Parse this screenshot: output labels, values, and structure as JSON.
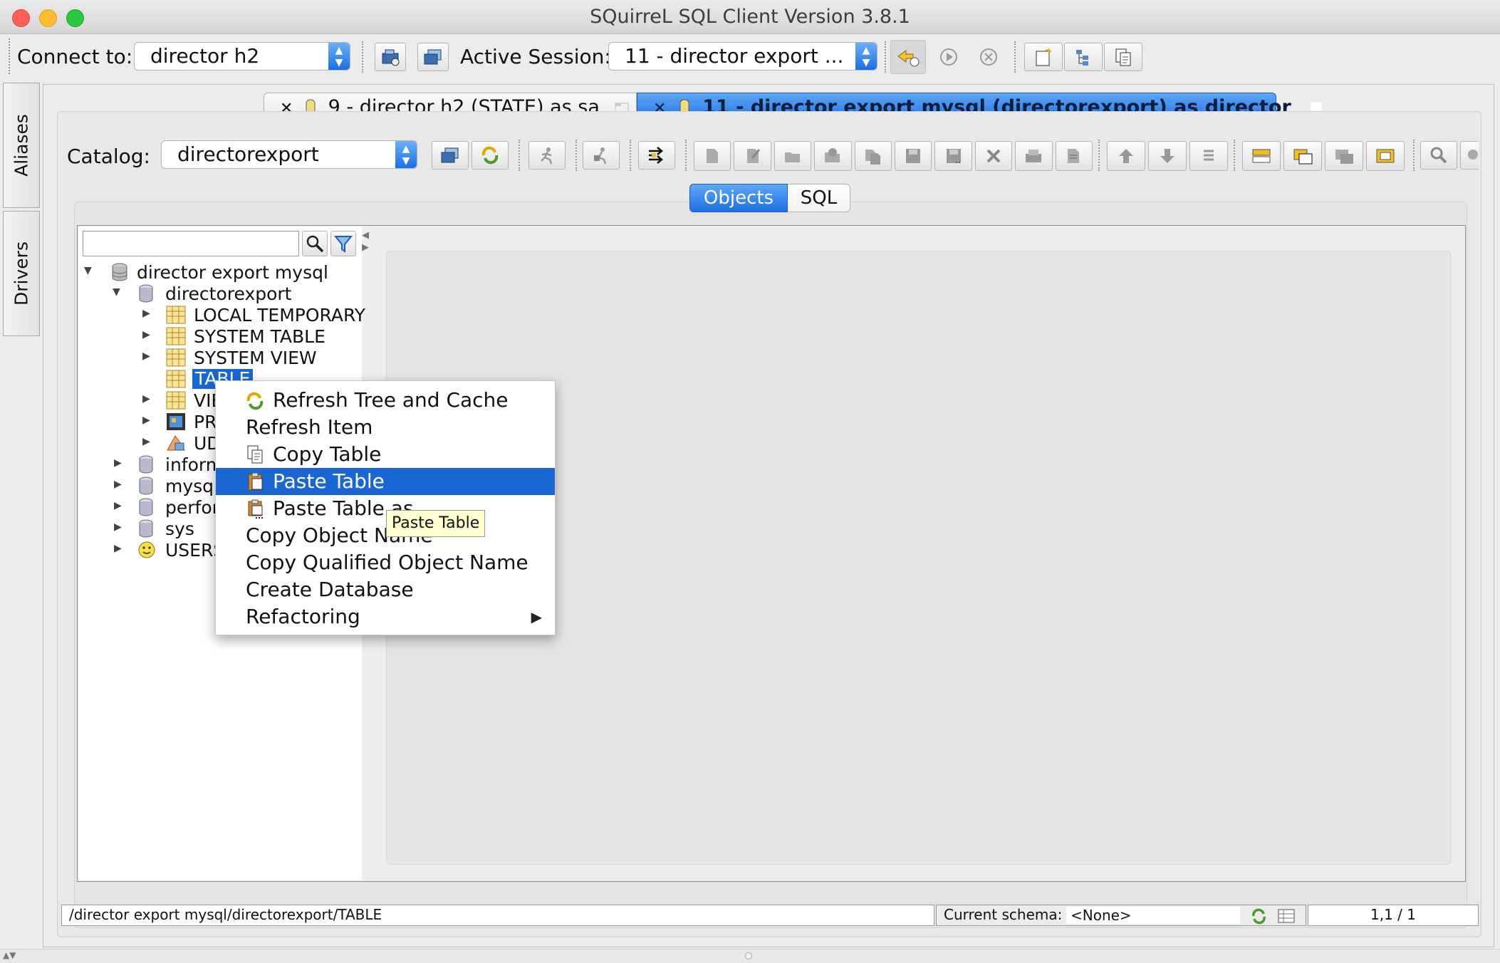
{
  "window": {
    "title": "SQuirreL SQL Client Version 3.8.1"
  },
  "toolbar": {
    "connect_label": "Connect to:",
    "connect_value": "director h2",
    "active_session_label": "Active Session:",
    "active_session_value": "11 - director export ..."
  },
  "side_tabs": {
    "aliases": "Aliases",
    "drivers": "Drivers"
  },
  "session_tabs": [
    {
      "label": "9 - director h2 (STATE) as sa",
      "active": false
    },
    {
      "label": "11 - director export mysql (directorexport) as director",
      "active": true
    }
  ],
  "session": {
    "catalog_label": "Catalog:",
    "catalog_value": "directorexport",
    "view_tabs": [
      {
        "label": "Objects",
        "active": true
      },
      {
        "label": "SQL",
        "active": false
      }
    ]
  },
  "tree": {
    "search_value": "",
    "root": "director export mysql",
    "schema": "directorexport",
    "children": [
      "LOCAL TEMPORARY",
      "SYSTEM TABLE",
      "SYSTEM VIEW",
      "TABLE",
      "VIE",
      "PR",
      "UD"
    ],
    "other_schemas": [
      "inform",
      "mysql",
      "perfor",
      "sys",
      "USERS"
    ]
  },
  "context_menu": {
    "items": [
      {
        "label": "Refresh Tree and Cache",
        "icon": "refresh-icon"
      },
      {
        "label": "Refresh Item"
      },
      {
        "label": "Copy Table",
        "icon": "copy-icon"
      },
      {
        "label": "Paste Table",
        "icon": "paste-icon",
        "selected": true
      },
      {
        "label": "Paste Table as",
        "icon": "paste-as-icon"
      },
      {
        "label": "Copy Object Name"
      },
      {
        "label": "Copy Qualified Object Name"
      },
      {
        "label": "Create Database"
      },
      {
        "label": "Refactoring",
        "submenu": true
      }
    ]
  },
  "tooltip": "Paste Table",
  "statusbar": {
    "path": "/director export mysql/directorexport/TABLE",
    "schema_label": "Current schema:",
    "schema_value": "<None>",
    "position": "1,1 / 1"
  },
  "colors": {
    "accent": "#1a67d4",
    "close": "#fe5f57",
    "minimize": "#febc2e",
    "zoom": "#28c840",
    "tooltip": "#ffffcf"
  }
}
